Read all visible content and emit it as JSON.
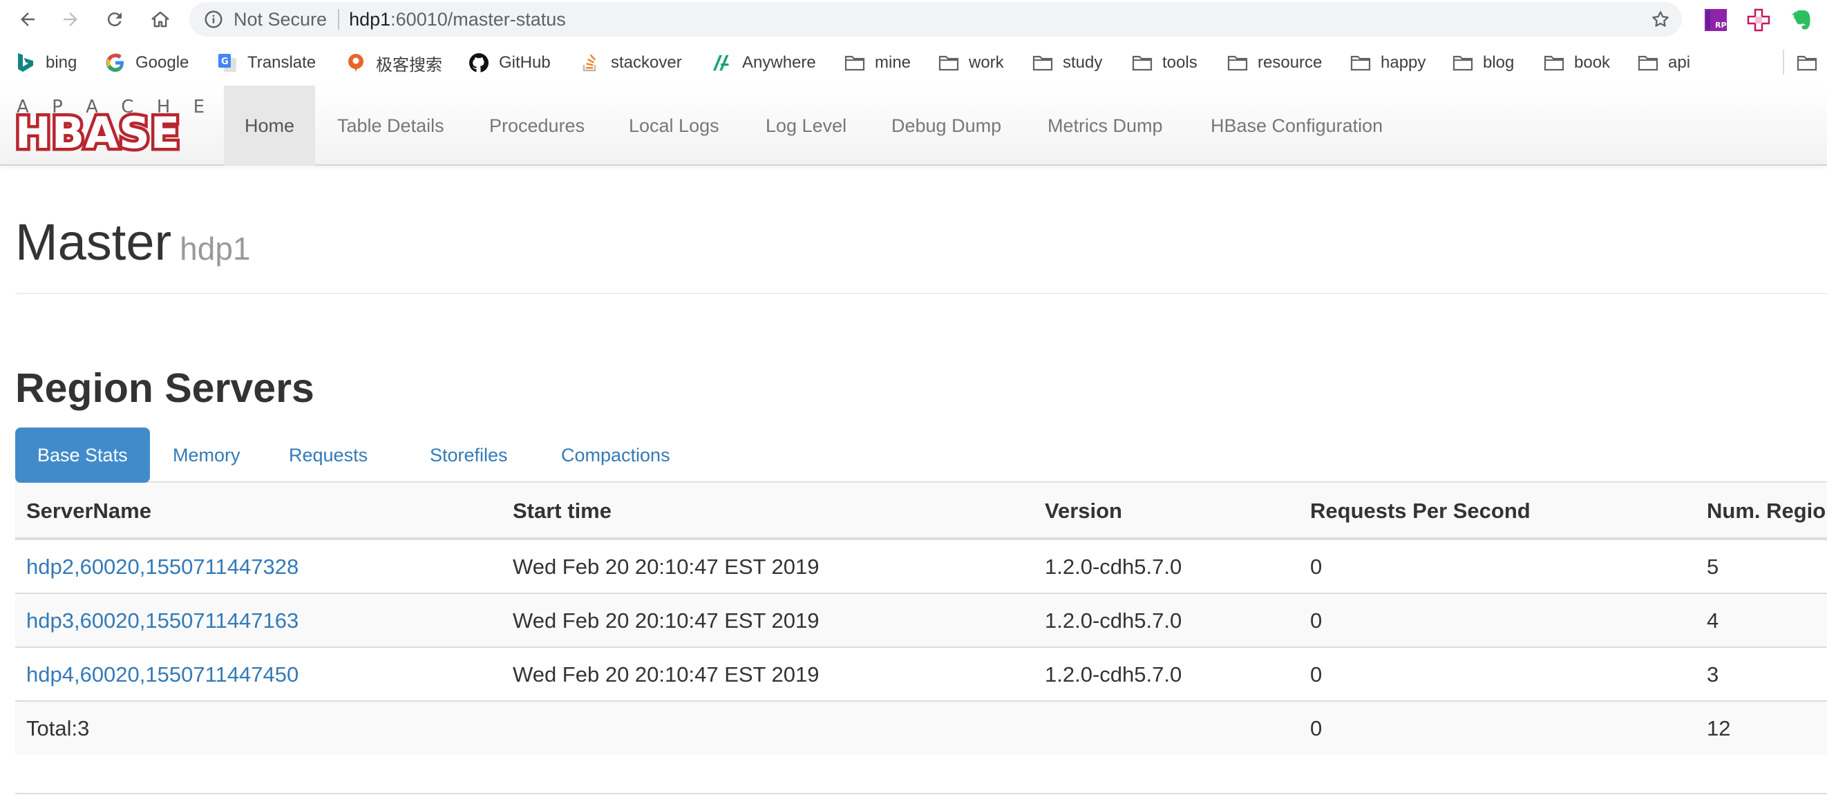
{
  "browser": {
    "security_label": "Not Secure",
    "url_host": "hdp1",
    "url_rest": ":60010/master-status",
    "bookmarks": [
      {
        "label": "bing",
        "icon": "bing-icon"
      },
      {
        "label": "Google",
        "icon": "google-icon"
      },
      {
        "label": "Translate",
        "icon": "translate-icon"
      },
      {
        "label": "极客搜索",
        "icon": "geek-search-icon"
      },
      {
        "label": "GitHub",
        "icon": "github-icon"
      },
      {
        "label": "stackover",
        "icon": "stackoverflow-icon"
      },
      {
        "label": "Anywhere",
        "icon": "anywhere-icon"
      },
      {
        "label": "mine",
        "icon": "folder-icon"
      },
      {
        "label": "work",
        "icon": "folder-icon"
      },
      {
        "label": "study",
        "icon": "folder-icon"
      },
      {
        "label": "tools",
        "icon": "folder-icon"
      },
      {
        "label": "resource",
        "icon": "folder-icon"
      },
      {
        "label": "happy",
        "icon": "folder-icon"
      },
      {
        "label": "blog",
        "icon": "folder-icon"
      },
      {
        "label": "book",
        "icon": "folder-icon"
      },
      {
        "label": "api",
        "icon": "folder-icon"
      }
    ]
  },
  "logo": {
    "top_text": "APACHE",
    "main_text": "HBASE",
    "color": "#b8262f"
  },
  "nav": {
    "items": [
      "Home",
      "Table Details",
      "Procedures",
      "Local Logs",
      "Log Level",
      "Debug Dump",
      "Metrics Dump",
      "HBase Configuration"
    ],
    "active": "Home"
  },
  "page": {
    "title": "Master",
    "subtitle": "hdp1",
    "section_title": "Region Servers"
  },
  "tabs": {
    "items": [
      "Base Stats",
      "Memory",
      "Requests",
      "Storefiles",
      "Compactions"
    ],
    "active": "Base Stats"
  },
  "table": {
    "headers": [
      "ServerName",
      "Start time",
      "Version",
      "Requests Per Second",
      "Num. Regio"
    ],
    "rows": [
      {
        "server": "hdp2,60020,1550711447328",
        "start": "Wed Feb 20 20:10:47 EST 2019",
        "version": "1.2.0-cdh5.7.0",
        "rps": "0",
        "regions": "5"
      },
      {
        "server": "hdp3,60020,1550711447163",
        "start": "Wed Feb 20 20:10:47 EST 2019",
        "version": "1.2.0-cdh5.7.0",
        "rps": "0",
        "regions": "4"
      },
      {
        "server": "hdp4,60020,1550711447450",
        "start": "Wed Feb 20 20:10:47 EST 2019",
        "version": "1.2.0-cdh5.7.0",
        "rps": "0",
        "regions": "3"
      }
    ],
    "total": {
      "label": "Total:3",
      "rps": "0",
      "regions": "12"
    }
  },
  "colors": {
    "link": "#337ab7",
    "active_tab": "#428bca",
    "logo_red": "#b8262f"
  }
}
